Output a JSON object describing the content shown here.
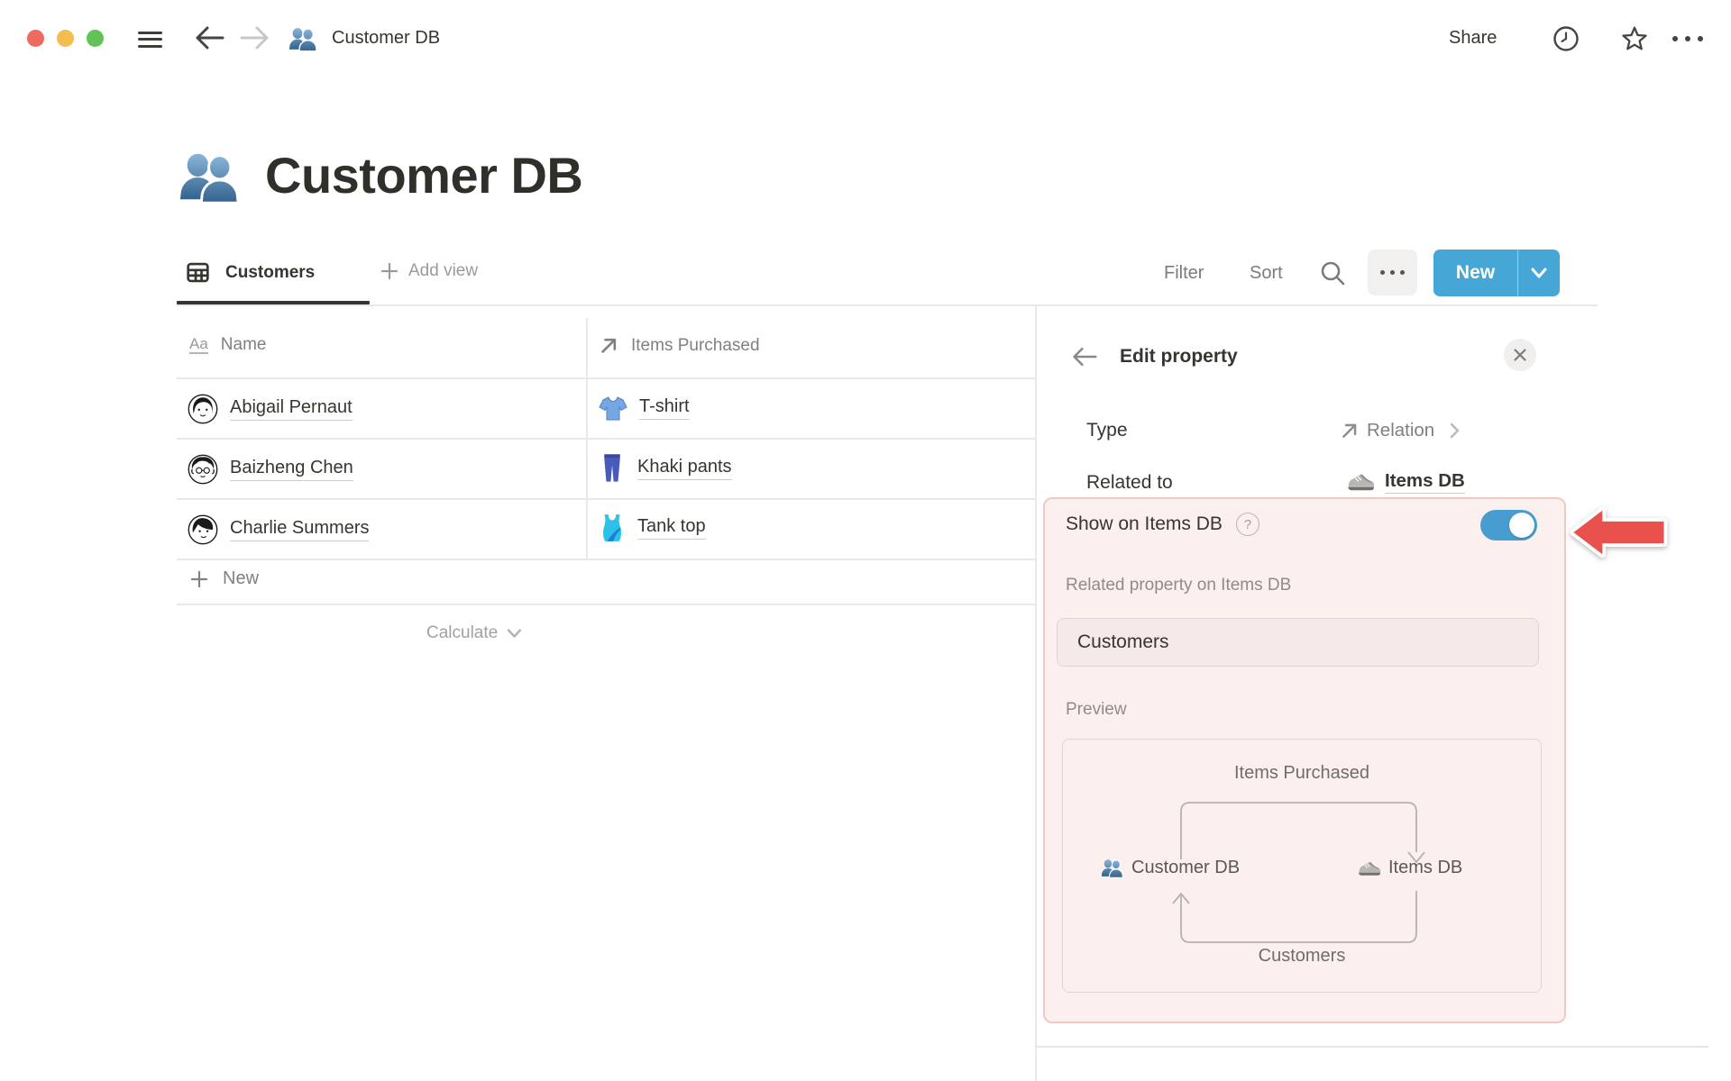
{
  "topbar": {
    "doc_title": "Customer DB",
    "share_label": "Share"
  },
  "page": {
    "icon": "people-icon",
    "title": "Customer DB"
  },
  "view_bar": {
    "tab_label": "Customers",
    "add_view_label": "Add view",
    "filter_label": "Filter",
    "sort_label": "Sort",
    "new_label": "New"
  },
  "table": {
    "columns": [
      {
        "icon": "title-property-icon",
        "icon_glyph": "Aa",
        "name": "Name"
      },
      {
        "icon": "relation-arrow-icon",
        "name": "Items Purchased"
      }
    ],
    "rows": [
      {
        "avatar": "woman-bob-avatar",
        "name": "Abigail Pernaut",
        "item_icon": "tshirt-icon",
        "item": "T-shirt"
      },
      {
        "avatar": "man-curly-glasses-avatar",
        "name": "Baizheng Chen",
        "item_icon": "jeans-icon",
        "item": "Khaki pants"
      },
      {
        "avatar": "person-short-hair-avatar",
        "name": "Charlie Summers",
        "item_icon": "tanktop-icon",
        "item": "Tank top"
      }
    ],
    "new_row_label": "New",
    "calculate_label": "Calculate"
  },
  "panel": {
    "title": "Edit property",
    "type_label": "Type",
    "type_value": "Relation",
    "related_label": "Related to",
    "related_value": "Items DB",
    "highlight": {
      "toggle_label": "Show on Items DB",
      "help_glyph": "?",
      "toggle_on": true,
      "related_property_label": "Related property on Items DB",
      "input_value": "Customers",
      "preview_label": "Preview",
      "preview": {
        "top_property": "Items Purchased",
        "left_node": "Customer DB",
        "right_node": "Items DB",
        "bottom_property": "Customers"
      }
    }
  },
  "colors": {
    "accent_blue_button": "#46a7d6",
    "accent_blue_toggle": "#479dcf",
    "highlight_pink_bg": "#fcf0ef",
    "highlight_pink_border": "#f4c6c2",
    "annotation_red": "#e9514d",
    "traffic_red": "#ee6a5f",
    "traffic_yellow": "#f5bd4f",
    "traffic_green": "#61c354"
  }
}
